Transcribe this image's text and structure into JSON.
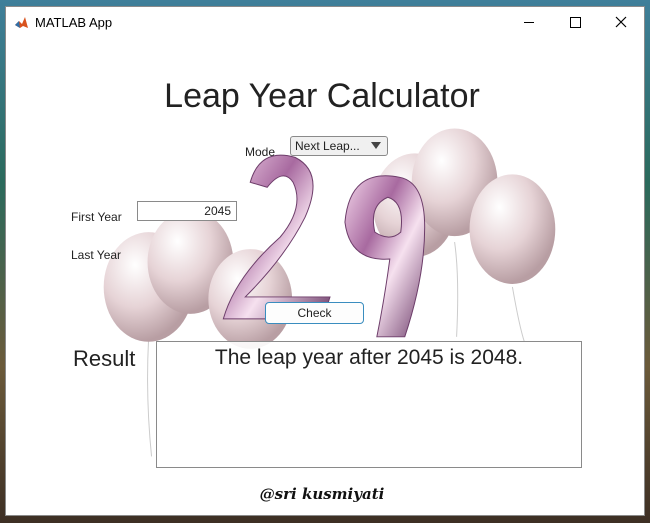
{
  "window": {
    "title": "MATLAB App",
    "icon": "matlab-logo-icon"
  },
  "app": {
    "heading": "Leap Year Calculator",
    "mode_label": "Mode",
    "mode_value": "Next Leap...",
    "first_year_label": "First Year",
    "first_year_value": "2045",
    "last_year_label": "Last Year",
    "check_button": "Check",
    "result_label": "Result",
    "result_text": "The leap year after 2045 is 2048.",
    "signature": "@sri kusmiyati",
    "decoration_number": "29"
  },
  "colors": {
    "balloon": "#e6d3d6",
    "number_29": "#b07aa8",
    "button_border": "#3a8dbf"
  }
}
